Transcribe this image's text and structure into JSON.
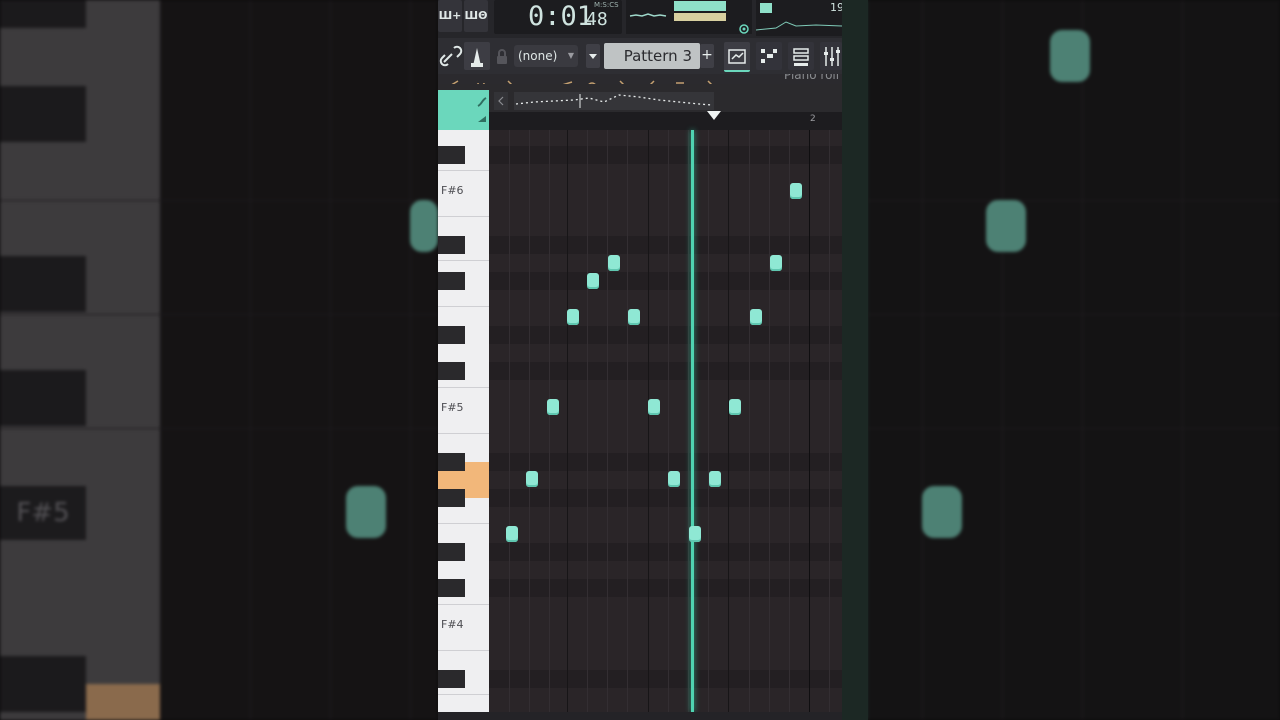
{
  "toolbar": {
    "btn1_label": "Ш+",
    "btn2_label": "ШΘ",
    "time_main": "0:01",
    "time_sub": "48",
    "time_format_label": "M:S:CS",
    "cpu_value": "19",
    "preset_select": "(none)",
    "pattern_name": "Pattern 3",
    "pattern_add": "+",
    "faded_label": "Piano roll"
  },
  "timeline": {
    "bar2_label": "2"
  },
  "piano_roll": {
    "key_labels": [
      "F#6",
      "F#5",
      "F#4"
    ],
    "highlighted_key": "C#5",
    "notes": [
      {
        "step": 1,
        "pitch": "C#5"
      },
      {
        "step": 2,
        "pitch": "D#5"
      },
      {
        "step": 3,
        "pitch": "F#5"
      },
      {
        "step": 4,
        "pitch": "A#5"
      },
      {
        "step": 5,
        "pitch": "B5"
      },
      {
        "step": 6,
        "pitch": "C#6"
      },
      {
        "step": 7,
        "pitch": "A#5"
      },
      {
        "step": 8,
        "pitch": "F#5"
      },
      {
        "step": 9,
        "pitch": "D#5"
      },
      {
        "step": 10,
        "pitch": "C#5"
      },
      {
        "step": 11,
        "pitch": "D#5"
      },
      {
        "step": 12,
        "pitch": "F#5"
      },
      {
        "step": 13,
        "pitch": "A#5"
      },
      {
        "step": 14,
        "pitch": "C#6"
      },
      {
        "step": 15,
        "pitch": "F#6"
      }
    ],
    "playhead_position_steps": 10.3,
    "note_color": "#8fe8d4",
    "accent_color": "#6bd7bc",
    "highlight_key_color": "#f2b77a"
  },
  "background": {
    "blurred_label": "F#5"
  }
}
